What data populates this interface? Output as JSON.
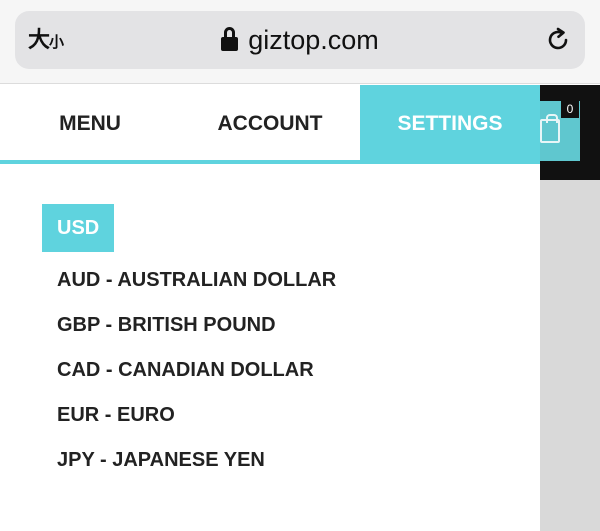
{
  "browser": {
    "text_size_large": "大",
    "text_size_small": "小",
    "domain": "giztop.com"
  },
  "header": {
    "cart_count": "0"
  },
  "drawer": {
    "tabs": [
      {
        "label": "MENU",
        "active": false
      },
      {
        "label": "ACCOUNT",
        "active": false
      },
      {
        "label": "SETTINGS",
        "active": true
      }
    ],
    "selected_currency": "USD",
    "currencies": [
      "AUD - AUSTRALIAN DOLLAR",
      "GBP - BRITISH POUND",
      "CAD - CANADIAN DOLLAR",
      "EUR - EURO",
      "JPY - JAPANESE YEN"
    ]
  },
  "colors": {
    "accent": "#5fd3de",
    "header_dark": "#111111",
    "cart_accent": "#5fc7cf"
  }
}
